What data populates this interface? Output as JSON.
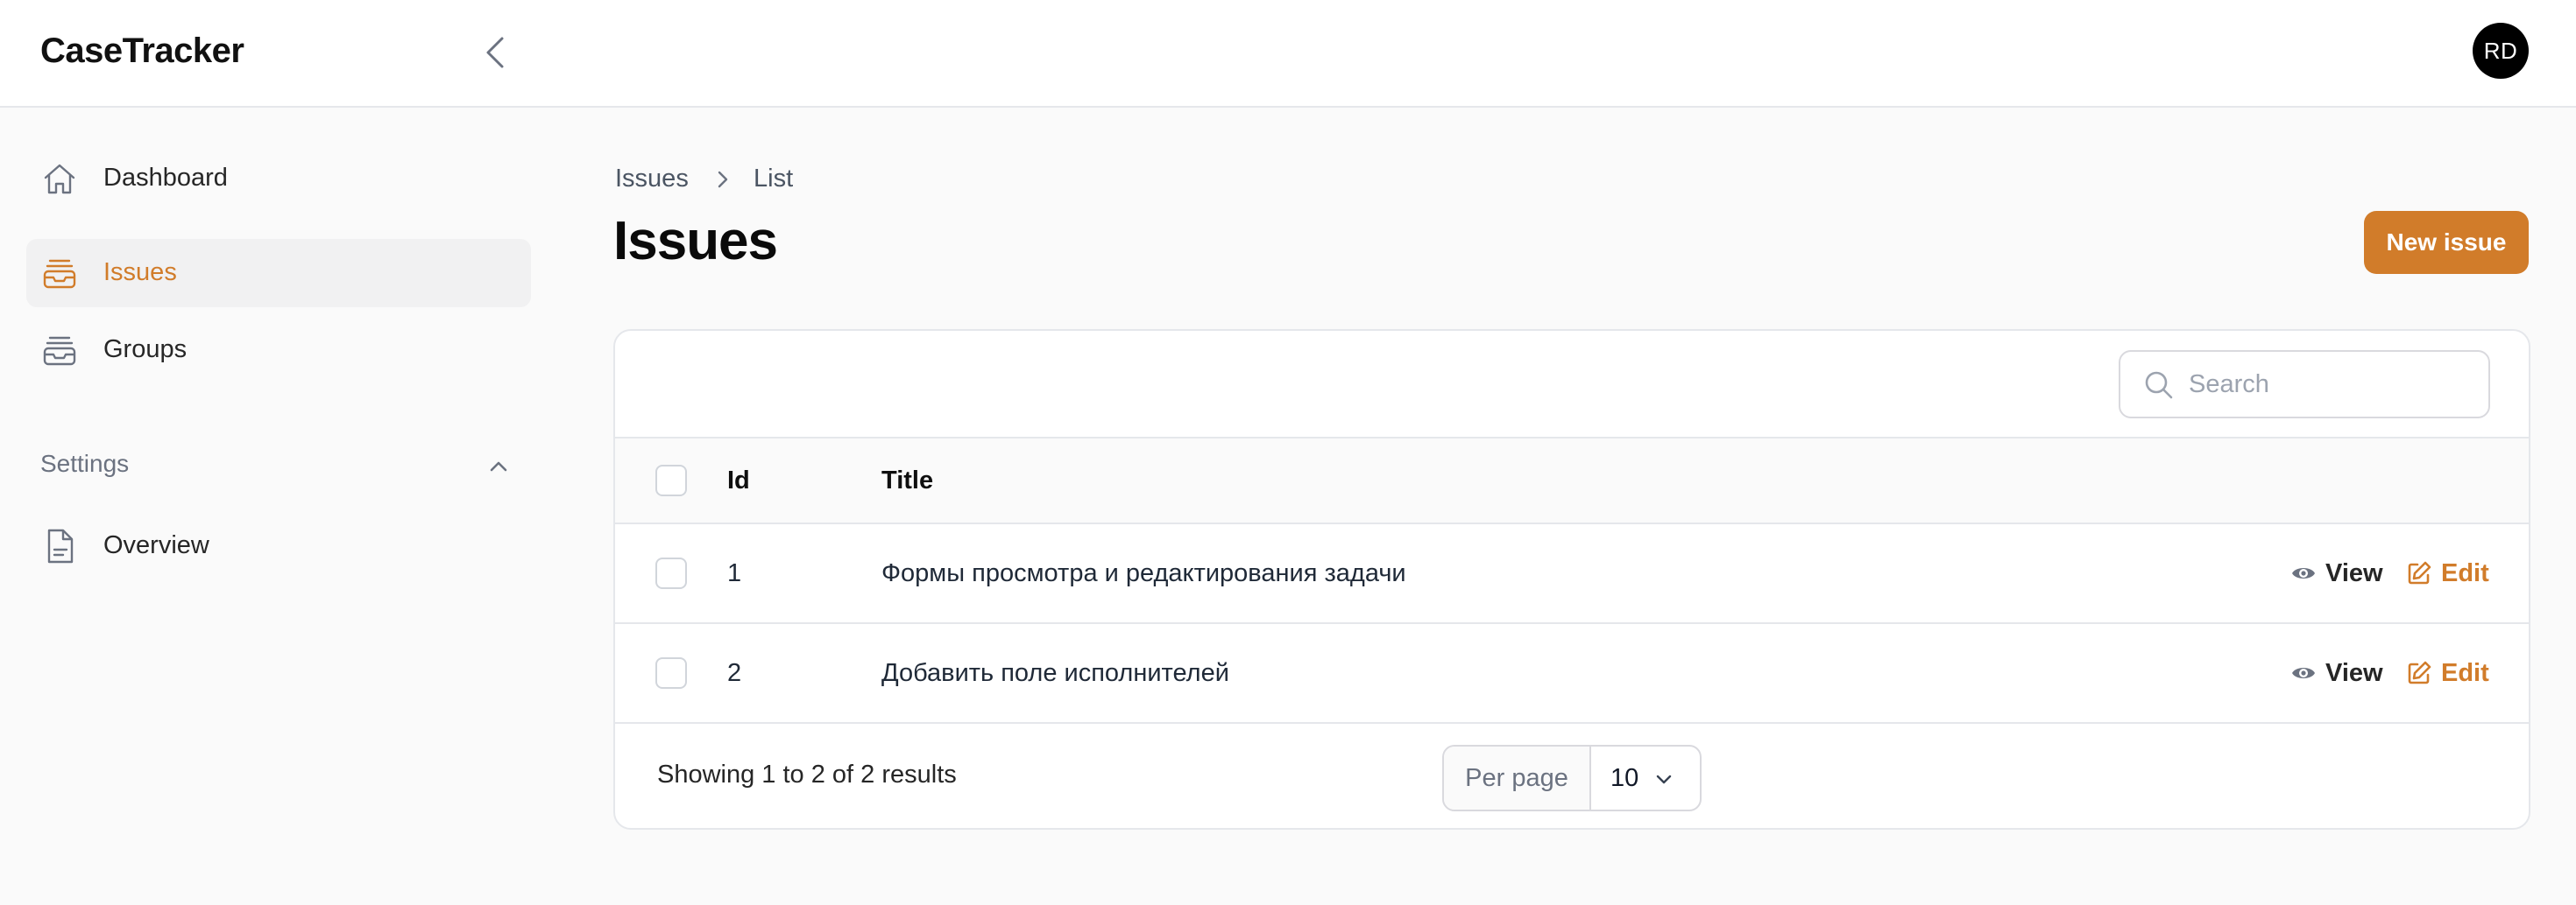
{
  "app": {
    "brand": "CaseTracker",
    "avatar_initials": "RD"
  },
  "sidebar": {
    "items": [
      {
        "label": "Dashboard",
        "icon": "home-icon",
        "active": false
      },
      {
        "label": "Issues",
        "icon": "inbox-stack-icon",
        "active": true
      },
      {
        "label": "Groups",
        "icon": "inbox-stack-icon",
        "active": false
      }
    ],
    "settings": {
      "label": "Settings",
      "items": [
        {
          "label": "Overview",
          "icon": "document-icon"
        }
      ]
    }
  },
  "breadcrumb": {
    "parent": "Issues",
    "current": "List"
  },
  "page": {
    "title": "Issues",
    "new_button": "New issue"
  },
  "search": {
    "placeholder": "Search",
    "value": ""
  },
  "table": {
    "columns": {
      "id": "Id",
      "title": "Title"
    },
    "rows": [
      {
        "id": "1",
        "title": "Формы просмотра и редактирования задачи"
      },
      {
        "id": "2",
        "title": "Добавить поле исполнителей"
      }
    ],
    "actions": {
      "view": "View",
      "edit": "Edit"
    }
  },
  "footer": {
    "results": "Showing 1 to 2 of 2 results",
    "per_page_label": "Per page",
    "per_page_value": "10"
  },
  "colors": {
    "accent": "#d17c2a",
    "avatar_bg": "#000000",
    "text": "#111827",
    "muted": "#6b7280"
  }
}
